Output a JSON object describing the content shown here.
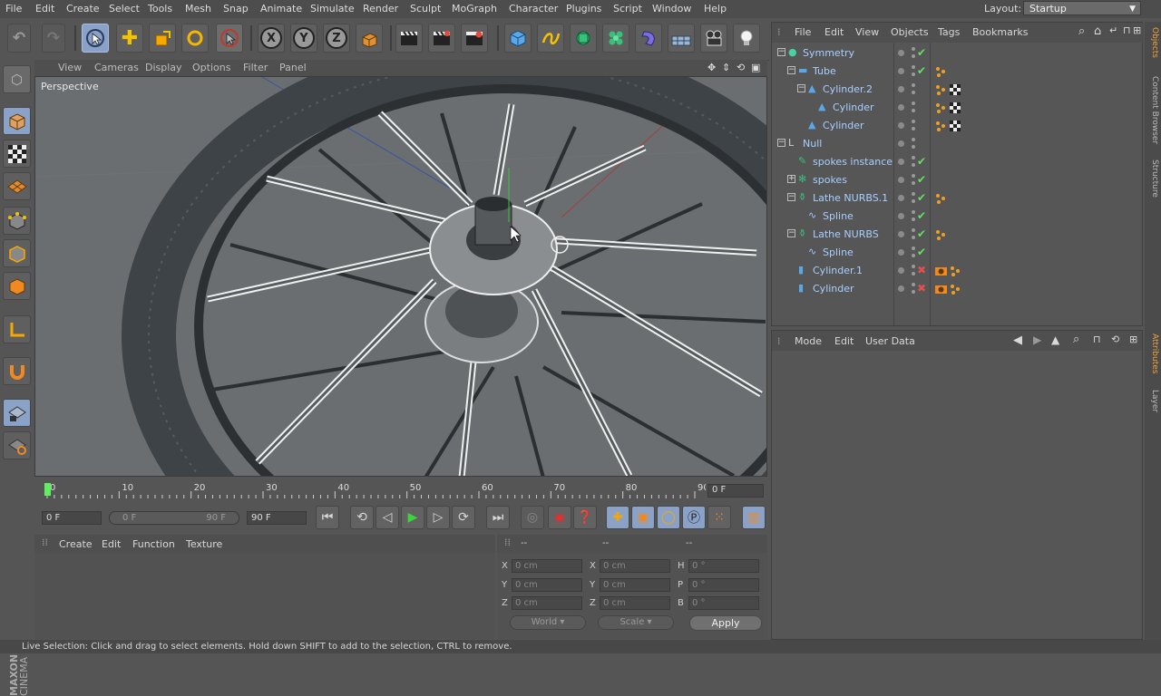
{
  "menubar": {
    "items": [
      "File",
      "Edit",
      "Create",
      "Select",
      "Tools",
      "Mesh",
      "Snap",
      "Animate",
      "Simulate",
      "Render",
      "Sculpt",
      "MoGraph",
      "Character",
      "Plugins",
      "Script",
      "Window",
      "Help"
    ],
    "layout_label": "Layout:",
    "layout_value": "Startup"
  },
  "toolbar": {
    "axis_x": "X",
    "axis_y": "Y",
    "axis_z": "Z"
  },
  "viewport": {
    "menu": [
      "View",
      "Cameras",
      "Display",
      "Options",
      "Filter",
      "Panel"
    ],
    "label": "Perspective"
  },
  "timeline": {
    "ticks": [
      "0",
      "10",
      "20",
      "30",
      "40",
      "50",
      "60",
      "70",
      "80",
      "90"
    ],
    "current_frame": "0 F"
  },
  "transport": {
    "start_field": "0 F",
    "range_start": "0 F",
    "range_end": "90 F",
    "end_field": "90 F"
  },
  "material": {
    "menu": [
      "Create",
      "Edit",
      "Function",
      "Texture"
    ]
  },
  "coords": {
    "header": [
      "--",
      "--",
      "--"
    ],
    "rows": [
      {
        "l1": "X",
        "v1": "0 cm",
        "l2": "X",
        "v2": "0 cm",
        "l3": "H",
        "v3": "0 °"
      },
      {
        "l1": "Y",
        "v1": "0 cm",
        "l2": "Y",
        "v2": "0 cm",
        "l3": "P",
        "v3": "0 °"
      },
      {
        "l1": "Z",
        "v1": "0 cm",
        "l2": "Z",
        "v2": "0 cm",
        "l3": "B",
        "v3": "0 °"
      }
    ],
    "mode_select": "World",
    "scale_select": "Scale",
    "apply": "Apply"
  },
  "objects": {
    "menu": [
      "File",
      "Edit",
      "View",
      "Objects",
      "Tags",
      "Bookmarks"
    ],
    "rows": [
      {
        "name": "Symmetry",
        "indent": 0,
        "icon": "symmetry-icon",
        "tree": "-",
        "state": "on",
        "tags": []
      },
      {
        "name": "Tube",
        "indent": 1,
        "icon": "tube-icon",
        "tree": "-",
        "state": "on",
        "tags": [
          "phong"
        ]
      },
      {
        "name": "Cylinder.2",
        "indent": 2,
        "icon": "cone-icon",
        "tree": "-",
        "state": "none",
        "tags": [
          "phong",
          "texture"
        ]
      },
      {
        "name": "Cylinder",
        "indent": 3,
        "icon": "cone-icon",
        "tree": "",
        "state": "none",
        "tags": [
          "phong",
          "texture"
        ]
      },
      {
        "name": "Cylinder",
        "indent": 2,
        "icon": "cone-icon",
        "tree": "",
        "state": "none",
        "tags": [
          "phong",
          "texture"
        ]
      },
      {
        "name": "Null",
        "indent": 0,
        "icon": "null-icon",
        "tree": "-",
        "state": "none",
        "tags": []
      },
      {
        "name": "spokes instance",
        "indent": 1,
        "icon": "instance-icon",
        "tree": "",
        "state": "on",
        "tags": []
      },
      {
        "name": "spokes",
        "indent": 1,
        "icon": "cloner-icon",
        "tree": "+",
        "state": "on",
        "tags": []
      },
      {
        "name": "Lathe NURBS.1",
        "indent": 1,
        "icon": "lathe-icon",
        "tree": "-",
        "state": "on",
        "tags": [
          "phong"
        ]
      },
      {
        "name": "Spline",
        "indent": 2,
        "icon": "spline-icon",
        "tree": "",
        "state": "on",
        "tags": []
      },
      {
        "name": "Lathe NURBS",
        "indent": 1,
        "icon": "lathe-icon",
        "tree": "-",
        "state": "on",
        "tags": [
          "phong"
        ]
      },
      {
        "name": "Spline",
        "indent": 2,
        "icon": "spline-icon",
        "tree": "",
        "state": "on",
        "tags": []
      },
      {
        "name": "Cylinder.1",
        "indent": 1,
        "icon": "cylinder-icon",
        "tree": "",
        "state": "off",
        "tags": [
          "compositing",
          "phong"
        ]
      },
      {
        "name": "Cylinder",
        "indent": 1,
        "icon": "cylinder-icon",
        "tree": "",
        "state": "off",
        "tags": [
          "compositing",
          "phong"
        ]
      }
    ]
  },
  "attributes": {
    "menu": [
      "Mode",
      "Edit",
      "User Data"
    ]
  },
  "sidetabs": [
    "Objects",
    "Content Browser",
    "Structure",
    "Attributes",
    "Layer"
  ],
  "brand": {
    "line1": "MAXON",
    "line2": "CINEMA 4D"
  },
  "status": "Live Selection: Click and drag to select elements. Hold down SHIFT to add to the selection, CTRL to remove.",
  "colors": {
    "accent": "#8aa2c8",
    "object_name": "#a8cfff",
    "check": "#64e064",
    "cross": "#e05050",
    "timeline_marker": "#5ef05e"
  }
}
